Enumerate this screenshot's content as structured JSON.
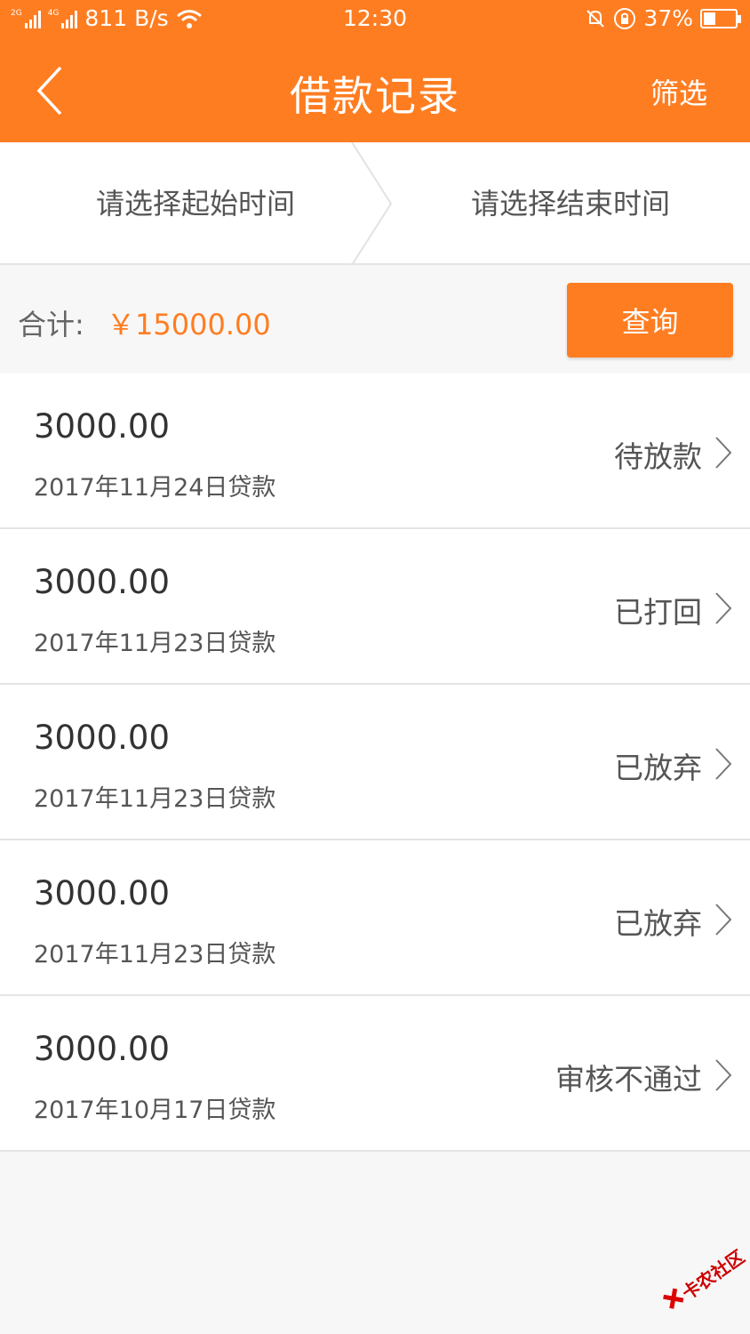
{
  "status_bar": {
    "net_2g": "2G",
    "net_4g": "4G",
    "speed": "811 B/s",
    "time": "12:30",
    "battery": "37%",
    "battery_level": 0.37
  },
  "nav": {
    "title": "借款记录",
    "filter_label": "筛选",
    "back_icon": "chevron-left-icon"
  },
  "date_range": {
    "start_placeholder": "请选择起始时间",
    "end_placeholder": "请选择结束时间"
  },
  "summary": {
    "label": "合计:",
    "amount": "￥15000.00",
    "query_button": "查询"
  },
  "loans": [
    {
      "amount": "3000.00",
      "date": "2017年11月24日贷款",
      "status": "待放款"
    },
    {
      "amount": "3000.00",
      "date": "2017年11月23日贷款",
      "status": "已打回"
    },
    {
      "amount": "3000.00",
      "date": "2017年11月23日贷款",
      "status": "已放弃"
    },
    {
      "amount": "3000.00",
      "date": "2017年11月23日贷款",
      "status": "已放弃"
    },
    {
      "amount": "3000.00",
      "date": "2017年10月17日贷款",
      "status": "审核不通过"
    }
  ],
  "watermark": {
    "text": "卡农社区"
  },
  "colors": {
    "accent": "#ff7d21"
  }
}
